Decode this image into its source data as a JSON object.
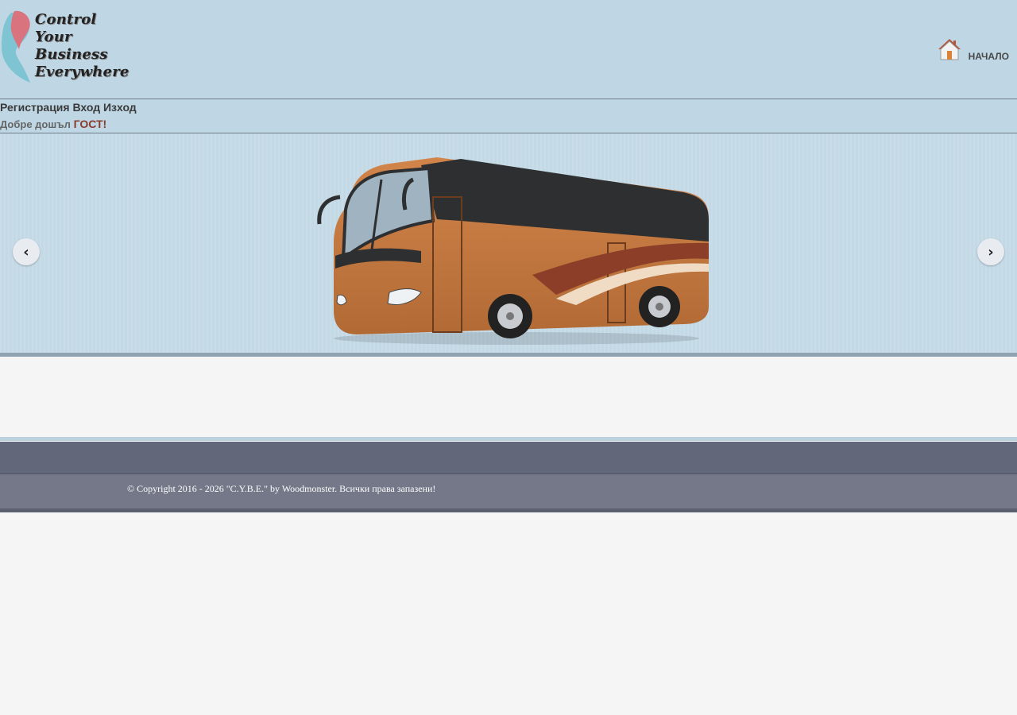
{
  "header": {
    "logo_lines": [
      "Control",
      "Your",
      "Business",
      "Everywhere"
    ],
    "nav_home_label": "НАЧАЛО",
    "nav_home_icon": "home-icon"
  },
  "userbar": {
    "register_label": "Регистрация",
    "login_label": "Вход",
    "logout_label": "Изход",
    "welcome_text": "Добре дошъл",
    "guest_name": "ГОСТ!"
  },
  "slider": {
    "prev_glyph": "‹",
    "next_glyph": "›",
    "slide_icon": "bus-image"
  },
  "footer": {
    "copyright": "© Copyright 2016 - 2026 \"C.Y.B.E.\" by Woodmonster. Всички права запазени!"
  },
  "colors": {
    "header_bg": "#bfd7e5",
    "footer_top": "#626779",
    "footer_bottom": "#747889",
    "guest_accent": "#8a3b2a"
  }
}
